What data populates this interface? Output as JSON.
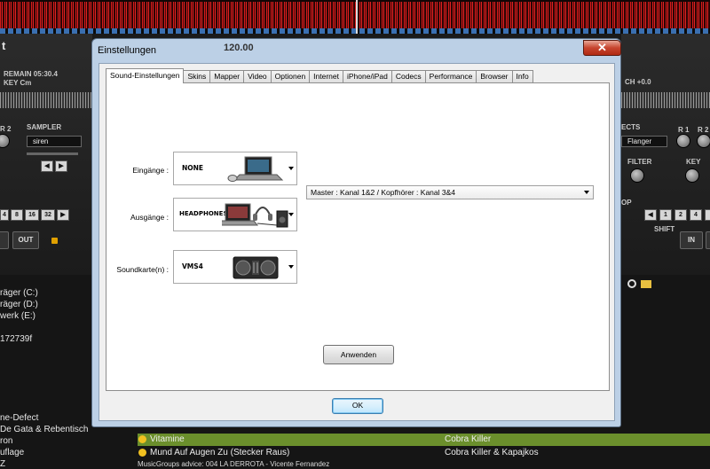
{
  "background": {
    "left_deck": {
      "title_char": "t",
      "remain": "REMAIN 05:30.4",
      "key": "KEY Cm",
      "sampler_label": "SAMPLER",
      "sampler_value": "siren",
      "knob_label": "R 2",
      "loop_buttons": [
        "4",
        "8",
        "16",
        "32"
      ],
      "out_label": "OUT"
    },
    "center_header": {
      "bpm": "120.00",
      "title_right": "Cobra Killer"
    },
    "right_deck": {
      "pitch": "CH +0.0",
      "effects_label": "ECTS",
      "effect_value": "Flanger",
      "knob_label": "R 1",
      "knob_label2": "R 2",
      "filter_label": "FILTER",
      "key_label": "KEY",
      "loop_label": "OP",
      "loop_buttons": [
        "1",
        "2",
        "4"
      ],
      "shift_label": "SHIFT",
      "in_label": "IN"
    },
    "tree_items": [
      "räger (C:)",
      "räger (D:)",
      "werk (E:)",
      "172739f"
    ],
    "playlist_left": [
      "ne-Defect",
      "De Gata & Rebentisch",
      "ron",
      "uflage",
      "Z"
    ],
    "tracks": [
      {
        "title": "Vitamine",
        "artist": "Cobra Killer",
        "selected": true
      },
      {
        "title": "Mund Auf Augen Zu (Stecker Raus)",
        "artist": "Cobra Killer & Kapajkos",
        "selected": false
      }
    ],
    "advice": "MusicGroups advice: 004 LA DERROTA - Vicente Fernandez"
  },
  "dialog": {
    "title": "Einstellungen",
    "close_label": "✕",
    "tabs": [
      "Sound-Einstellungen",
      "Skins",
      "Mapper",
      "Video",
      "Optionen",
      "Internet",
      "iPhone/iPad",
      "Codecs",
      "Performance",
      "Browser",
      "Info"
    ],
    "active_tab": 0,
    "rows": [
      {
        "label": "Eingänge :",
        "device": "NONE",
        "icon": "laptop-with-mouse-icon"
      },
      {
        "label": "Ausgänge :",
        "device": "HEADPHONES",
        "icon": "laptop-with-headphones-icon"
      },
      {
        "label": "Soundkarte(n) :",
        "device": "VMS4",
        "icon": "dj-controller-icon"
      }
    ],
    "output_select": "Master : Kanal 1&2 / Kopfhörer : Kanal 3&4",
    "apply_label": "Anwenden",
    "ok_label": "OK"
  }
}
